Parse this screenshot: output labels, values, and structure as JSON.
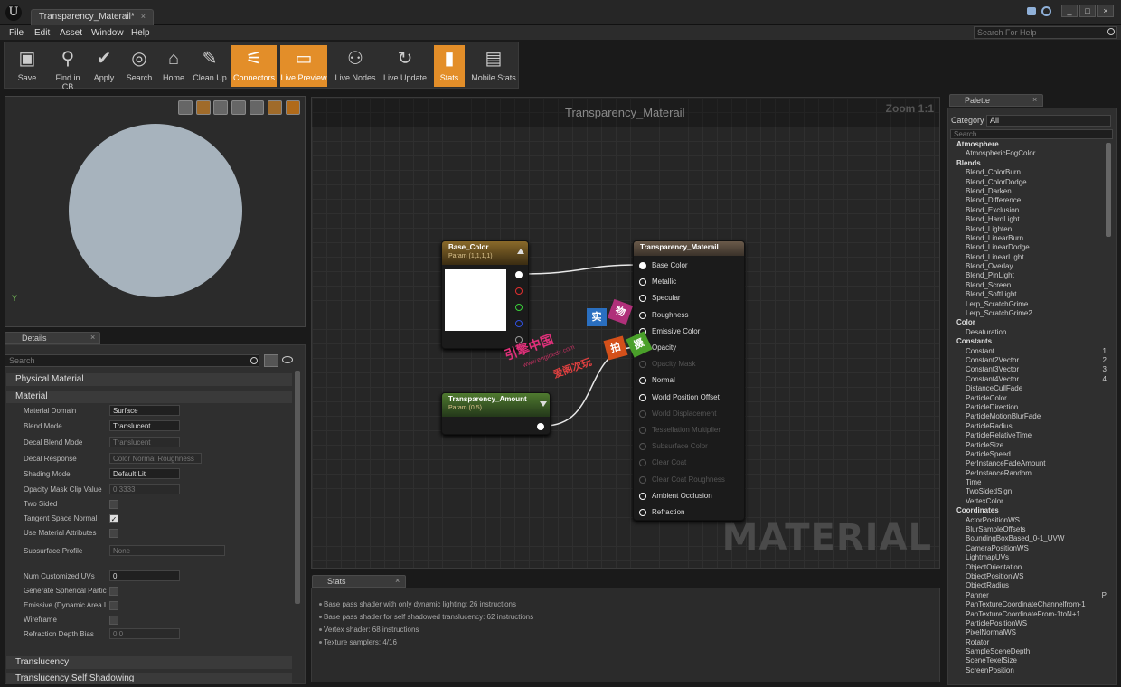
{
  "window": {
    "tab_title": "Transparency_Materail*",
    "logo": "U",
    "close_glyph": "×"
  },
  "menu": {
    "items": [
      "File",
      "Edit",
      "Asset",
      "Window",
      "Help"
    ],
    "help_search_placeholder": "Search For Help"
  },
  "toolbar": {
    "buttons": [
      {
        "label": "Save",
        "icon": "save-icon",
        "active": false
      },
      {
        "label": "Find in CB",
        "icon": "magnifier-icon",
        "active": false
      },
      {
        "label": "Apply",
        "icon": "checkmark-icon",
        "active": false
      },
      {
        "label": "Search",
        "icon": "binoculars-icon",
        "active": false
      },
      {
        "label": "Home",
        "icon": "house-icon",
        "active": false
      },
      {
        "label": "Clean Up",
        "icon": "broom-icon",
        "active": false
      },
      {
        "label": "Connectors",
        "icon": "connectors-icon",
        "active": true
      },
      {
        "label": "Live Preview",
        "icon": "monitor-icon",
        "active": true
      },
      {
        "label": "Live Nodes",
        "icon": "nodes-icon",
        "active": false
      },
      {
        "label": "Live Update",
        "icon": "refresh-icon",
        "active": false
      },
      {
        "label": "Stats",
        "icon": "bar-chart-icon",
        "active": true
      },
      {
        "label": "Mobile Stats",
        "icon": "mobile-stats-icon",
        "active": false
      }
    ],
    "active_color": "#e38e29"
  },
  "viewport": {
    "sphere_color": "#a7b3bd",
    "axis_label": "Y"
  },
  "details": {
    "tab_label": "Details",
    "search_placeholder": "Search",
    "sections": {
      "physical": "Physical Material",
      "material": "Material",
      "translucency": "Translucency",
      "translucency_shadow": "Translucency Self Shadowing"
    },
    "props": {
      "domain_label": "Material Domain",
      "domain_value": "Surface",
      "blend_label": "Blend Mode",
      "blend_value": "Translucent",
      "decal_blend_label": "Decal Blend Mode",
      "decal_blend_value": "Translucent",
      "decal_resp_label": "Decal Response",
      "decal_resp_value": "Color Normal Roughness",
      "shading_label": "Shading Model",
      "shading_value": "Default Lit",
      "opacity_clip_label": "Opacity Mask Clip Value",
      "opacity_clip_value": "0.3333",
      "two_sided_label": "Two Sided",
      "tangent_label": "Tangent Space Normal",
      "use_attr_label": "Use Material Attributes",
      "subsurface_label": "Subsurface Profile",
      "subsurface_value": "None",
      "num_uvs_label": "Num Customized UVs",
      "num_uvs_value": "0",
      "gen_sph_label": "Generate Spherical Partic",
      "emissive_label": "Emissive (Dynamic Area I",
      "wireframe_label": "Wireframe",
      "refraction_label": "Refraction Depth Bias",
      "refraction_value": "0.0"
    }
  },
  "graph": {
    "title": "Transparency_Materail",
    "zoom": "Zoom 1:1",
    "watermark": "MATERIAL",
    "base_color_node": {
      "title": "Base_Color",
      "sub": "Param (1,1,1,1)",
      "color": "#8a6a2a"
    },
    "transparency_node": {
      "title": "Transparency_Amount",
      "sub": "Param (0.5)",
      "color": "#4f7a2f"
    },
    "material_node": {
      "title": "Transparency_Materail",
      "pins": [
        {
          "label": "Base Color",
          "enabled": true
        },
        {
          "label": "Metallic",
          "enabled": true
        },
        {
          "label": "Specular",
          "enabled": true
        },
        {
          "label": "Roughness",
          "enabled": true
        },
        {
          "label": "Emissive Color",
          "enabled": true
        },
        {
          "label": "Opacity",
          "enabled": true
        },
        {
          "label": "Opacity Mask",
          "enabled": false
        },
        {
          "label": "Normal",
          "enabled": true
        },
        {
          "label": "World Position Offset",
          "enabled": true
        },
        {
          "label": "World Displacement",
          "enabled": false
        },
        {
          "label": "Tessellation Multiplier",
          "enabled": false
        },
        {
          "label": "Subsurface Color",
          "enabled": false
        },
        {
          "label": "Clear Coat",
          "enabled": false
        },
        {
          "label": "Clear Coat Roughness",
          "enabled": false
        },
        {
          "label": "Ambient Occlusion",
          "enabled": true
        },
        {
          "label": "Refraction",
          "enabled": true
        }
      ]
    },
    "overlay": {
      "text1": "引擎中国",
      "text2": "www.enginedx.com",
      "text3": "爱阁次玩",
      "tile1": "实",
      "tile2": "物",
      "tile3": "拍",
      "tile4": "摄"
    }
  },
  "stats": {
    "tab_label": "Stats",
    "lines": [
      "Base pass shader with only dynamic lighting: 26 instructions",
      "Base pass shader for self shadowed translucency: 62 instructions",
      "Vertex shader: 68 instructions",
      "Texture samplers: 4/16"
    ]
  },
  "palette": {
    "tab_label": "Palette",
    "category_label": "Category",
    "category_value": "All",
    "search_placeholder": "Search",
    "groups": [
      {
        "name": "Atmosphere",
        "items": [
          {
            "name": "AtmosphericFogColor"
          }
        ]
      },
      {
        "name": "Blends",
        "items": [
          {
            "name": "Blend_ColorBurn"
          },
          {
            "name": "Blend_ColorDodge"
          },
          {
            "name": "Blend_Darken"
          },
          {
            "name": "Blend_Difference"
          },
          {
            "name": "Blend_Exclusion"
          },
          {
            "name": "Blend_HardLight"
          },
          {
            "name": "Blend_Lighten"
          },
          {
            "name": "Blend_LinearBurn"
          },
          {
            "name": "Blend_LinearDodge"
          },
          {
            "name": "Blend_LinearLight"
          },
          {
            "name": "Blend_Overlay"
          },
          {
            "name": "Blend_PinLight"
          },
          {
            "name": "Blend_Screen"
          },
          {
            "name": "Blend_SoftLight"
          },
          {
            "name": "Lerp_ScratchGrime"
          },
          {
            "name": "Lerp_ScratchGrime2"
          }
        ]
      },
      {
        "name": "Color",
        "items": [
          {
            "name": "Desaturation"
          }
        ]
      },
      {
        "name": "Constants",
        "items": [
          {
            "name": "Constant",
            "shortcut": "1"
          },
          {
            "name": "Constant2Vector",
            "shortcut": "2"
          },
          {
            "name": "Constant3Vector",
            "shortcut": "3"
          },
          {
            "name": "Constant4Vector",
            "shortcut": "4"
          },
          {
            "name": "DistanceCullFade"
          },
          {
            "name": "ParticleColor"
          },
          {
            "name": "ParticleDirection"
          },
          {
            "name": "ParticleMotionBlurFade"
          },
          {
            "name": "ParticleRadius"
          },
          {
            "name": "ParticleRelativeTime"
          },
          {
            "name": "ParticleSize"
          },
          {
            "name": "ParticleSpeed"
          },
          {
            "name": "PerInstanceFadeAmount"
          },
          {
            "name": "PerInstanceRandom"
          },
          {
            "name": "Time"
          },
          {
            "name": "TwoSidedSign"
          },
          {
            "name": "VertexColor"
          }
        ]
      },
      {
        "name": "Coordinates",
        "items": [
          {
            "name": "ActorPositionWS"
          },
          {
            "name": "BlurSampleOffsets"
          },
          {
            "name": "BoundingBoxBased_0-1_UVW"
          },
          {
            "name": "CameraPositionWS"
          },
          {
            "name": "LightmapUVs"
          },
          {
            "name": "ObjectOrientation"
          },
          {
            "name": "ObjectPositionWS"
          },
          {
            "name": "ObjectRadius"
          },
          {
            "name": "Panner",
            "shortcut": "P"
          },
          {
            "name": "PanTextureCoordinateChannelfrom-1"
          },
          {
            "name": "PanTextureCoordinateFrom-1toN+1"
          },
          {
            "name": "ParticlePositionWS"
          },
          {
            "name": "PixelNormalWS"
          },
          {
            "name": "Rotator"
          },
          {
            "name": "SampleSceneDepth"
          },
          {
            "name": "SceneTexelSize"
          },
          {
            "name": "ScreenPosition"
          }
        ]
      }
    ]
  }
}
